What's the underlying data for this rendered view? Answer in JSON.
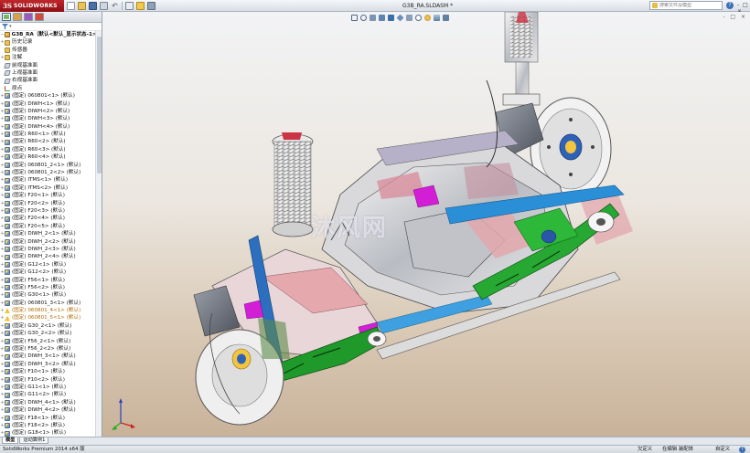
{
  "app": {
    "logo_ds": "3S",
    "logo_name": "SOLIDWORKS",
    "document_title": "G3B_RA.SLDASM *"
  },
  "toolbar": {
    "search_placeholder": "搜索文件及模型",
    "help_label": "?",
    "window_controls": "- □ ×",
    "icons": [
      "new-icon",
      "open-icon",
      "save-icon",
      "print-icon",
      "undo-icon",
      "select-icon",
      "rebuild-icon",
      "options-icon"
    ]
  },
  "panel": {
    "tabs": [
      "feature-manager",
      "property-manager",
      "configuration-manager",
      "display-manager"
    ],
    "filter_arrow": "▾"
  },
  "tree": {
    "root": "G3B_RA（默认<默认_显示状态-1>）",
    "items": [
      {
        "label": "历史记录",
        "icon": "folder",
        "exp": "+"
      },
      {
        "label": "传感器",
        "icon": "folder",
        "exp": ""
      },
      {
        "label": "注解",
        "icon": "folder",
        "exp": "+"
      },
      {
        "label": "前视基准面",
        "icon": "plane",
        "exp": ""
      },
      {
        "label": "上视基准面",
        "icon": "plane",
        "exp": ""
      },
      {
        "label": "右视基准面",
        "icon": "plane",
        "exp": ""
      },
      {
        "label": "原点",
        "icon": "origin",
        "exp": ""
      },
      {
        "label": "(固定) 060801<1> (默认)",
        "icon": "comp",
        "exp": "+"
      },
      {
        "label": "(固定) DIWH<1> (默认)",
        "icon": "comp",
        "exp": "+"
      },
      {
        "label": "(固定) DIWH<2> (默认)",
        "icon": "comp",
        "exp": "+"
      },
      {
        "label": "(固定) DIWH<3> (默认)",
        "icon": "comp",
        "exp": "+"
      },
      {
        "label": "(固定) DIWH<4> (默认)",
        "icon": "comp",
        "exp": "+"
      },
      {
        "label": "(固定) R60<1> (默认)",
        "icon": "comp",
        "exp": "+"
      },
      {
        "label": "(固定) R60<2> (默认)",
        "icon": "comp",
        "exp": "+"
      },
      {
        "label": "(固定) R60<3> (默认)",
        "icon": "comp",
        "exp": "+"
      },
      {
        "label": "(固定) R60<4> (默认)",
        "icon": "comp",
        "exp": "+"
      },
      {
        "label": "(固定) 060801_2<1> (默认)",
        "icon": "comp",
        "exp": "+"
      },
      {
        "label": "(固定) 060801_2<2> (默认)",
        "icon": "comp",
        "exp": "+"
      },
      {
        "label": "(固定) ITMS<1> (默认)",
        "icon": "comp",
        "exp": "+"
      },
      {
        "label": "(固定) ITMS<2> (默认)",
        "icon": "comp",
        "exp": "+"
      },
      {
        "label": "(固定) F20<1> (默认)",
        "icon": "comp",
        "exp": "+"
      },
      {
        "label": "(固定) F20<2> (默认)",
        "icon": "comp",
        "exp": "+"
      },
      {
        "label": "(固定) F20<3> (默认)",
        "icon": "comp",
        "exp": "+"
      },
      {
        "label": "(固定) F20<4> (默认)",
        "icon": "comp",
        "exp": "+"
      },
      {
        "label": "(固定) F20<5> (默认)",
        "icon": "comp",
        "exp": "+"
      },
      {
        "label": "(固定) DIWH_2<1> (默认)",
        "icon": "comp",
        "exp": "+"
      },
      {
        "label": "(固定) DIWH_2<2> (默认)",
        "icon": "comp",
        "exp": "+"
      },
      {
        "label": "(固定) DIWH_2<3> (默认)",
        "icon": "comp",
        "exp": "+"
      },
      {
        "label": "(固定) DIWH_2<4> (默认)",
        "icon": "comp",
        "exp": "+"
      },
      {
        "label": "(固定) G12<1> (默认)",
        "icon": "comp",
        "exp": "+"
      },
      {
        "label": "(固定) G12<2> (默认)",
        "icon": "comp",
        "exp": "+"
      },
      {
        "label": "(固定) F56<1> (默认)",
        "icon": "comp",
        "exp": "+"
      },
      {
        "label": "(固定) F56<2> (默认)",
        "icon": "comp",
        "exp": "+"
      },
      {
        "label": "(固定) G30<1> (默认)",
        "icon": "comp",
        "exp": "+"
      },
      {
        "label": "(固定) 060801_3<1> (默认)",
        "icon": "comp",
        "exp": "+"
      },
      {
        "label": "(固定) 060801_4<1> (默认)",
        "icon": "warn",
        "exp": "+"
      },
      {
        "label": "(固定) 060801_5<1> (默认)",
        "icon": "warn",
        "exp": "+"
      },
      {
        "label": "(固定) G30_2<1> (默认)",
        "icon": "comp",
        "exp": "+"
      },
      {
        "label": "(固定) G30_2<2> (默认)",
        "icon": "comp",
        "exp": "+"
      },
      {
        "label": "(固定) F56_2<1> (默认)",
        "icon": "comp",
        "exp": "+"
      },
      {
        "label": "(固定) F56_2<2> (默认)",
        "icon": "comp",
        "exp": "+"
      },
      {
        "label": "(固定) DIWH_3<1> (默认)",
        "icon": "comp",
        "exp": "+"
      },
      {
        "label": "(固定) DIWH_3<2> (默认)",
        "icon": "comp",
        "exp": "+"
      },
      {
        "label": "(固定) F10<1> (默认)",
        "icon": "comp",
        "exp": "+"
      },
      {
        "label": "(固定) F10<2> (默认)",
        "icon": "comp",
        "exp": "+"
      },
      {
        "label": "(固定) G11<1> (默认)",
        "icon": "comp",
        "exp": "+"
      },
      {
        "label": "(固定) G11<2> (默认)",
        "icon": "comp",
        "exp": "+"
      },
      {
        "label": "(固定) DIWH_4<1> (默认)",
        "icon": "comp",
        "exp": "+"
      },
      {
        "label": "(固定) DIWH_4<2> (默认)",
        "icon": "comp",
        "exp": "+"
      },
      {
        "label": "(固定) F18<1> (默认)",
        "icon": "comp",
        "exp": "+"
      },
      {
        "label": "(固定) F18<2> (默认)",
        "icon": "comp",
        "exp": "+"
      },
      {
        "label": "(固定) G18<1> (默认)",
        "icon": "comp",
        "exp": "+"
      }
    ]
  },
  "viewport": {
    "heads_up_icons": [
      "zoom-to-fit-icon",
      "zoom-area-icon",
      "previous-view-icon",
      "section-view-icon",
      "dynamic-annotation-icon",
      "view-orientation-icon",
      "display-style-icon",
      "hide-show-icon",
      "edit-appearance-icon",
      "apply-scene-icon",
      "view-settings-icon"
    ],
    "controls": "- □ ×",
    "watermark": "沐风网"
  },
  "bottom_tabs": [
    "模型",
    "运动算例1"
  ],
  "status": {
    "left": "SolidWorks Premium 2014 x64 版",
    "undefined": "欠定义",
    "mode": "在编辑 装配体",
    "units": "自定义",
    "help": "?"
  },
  "colors": {
    "logo_red": "#b0191e",
    "link_green": "#1f9a2a",
    "arm_blue": "#2a8fd6",
    "bracket_magenta": "#d21fd6",
    "spring_pink": "#e07a7a"
  }
}
